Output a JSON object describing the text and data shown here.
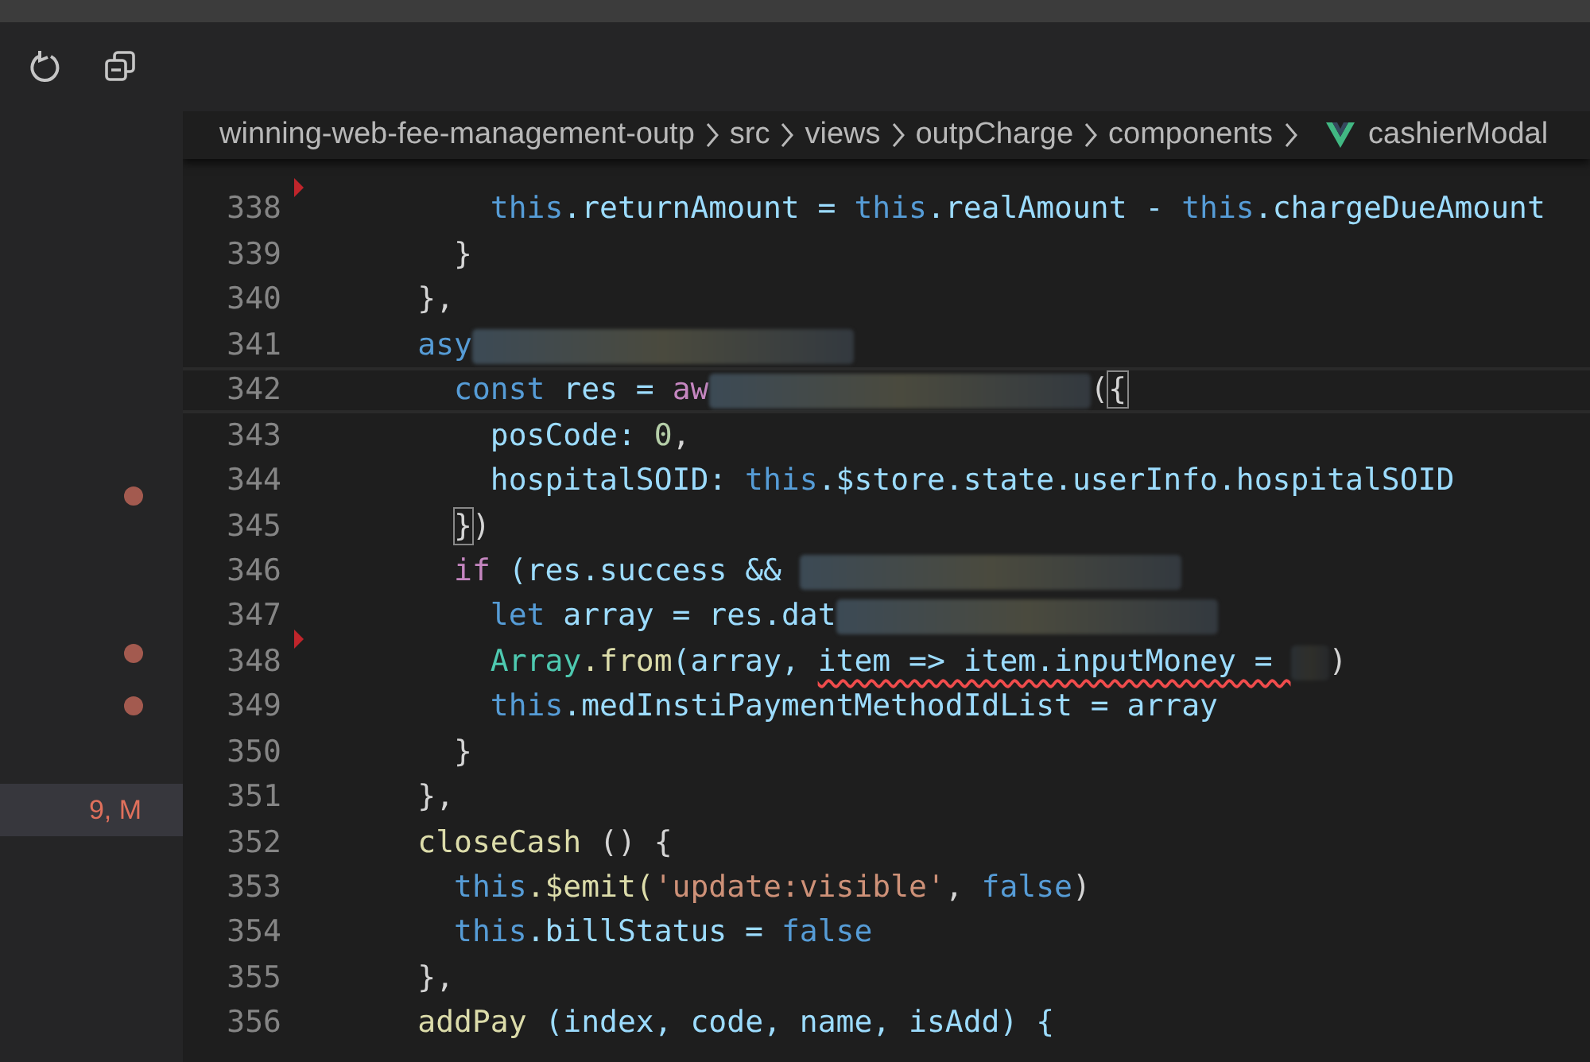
{
  "toolbar": {
    "buttons": [
      {
        "kind": "refresh"
      },
      {
        "kind": "collapse"
      }
    ]
  },
  "sidebar": {
    "rows": [
      {
        "kind": "dot",
        "selected": false
      },
      {
        "kind": "blank",
        "selected": false
      },
      {
        "kind": "blank",
        "selected": false
      },
      {
        "kind": "dot",
        "selected": false
      },
      {
        "kind": "dot",
        "selected": false
      },
      {
        "kind": "blank",
        "selected": false
      },
      {
        "kind": "badge",
        "text": "9, M",
        "selected": true
      }
    ]
  },
  "breadcrumb": [
    {
      "text": "winning-web-fee-management-outp"
    },
    {
      "text": "src"
    },
    {
      "text": "views"
    },
    {
      "text": "outpCharge"
    },
    {
      "text": "components"
    },
    {
      "text": "cashierModal",
      "kind": "vue"
    }
  ],
  "editor": {
    "lines": [
      {
        "number": "338",
        "marker": true,
        "current": false,
        "tokens": [
          {
            "text": "          this",
            "kind": "kw"
          },
          {
            "text": ".returnAmount = ",
            "kind": "var"
          },
          {
            "text": "this",
            "kind": "kw"
          },
          {
            "text": ".realAmount - ",
            "kind": "var"
          },
          {
            "text": "this",
            "kind": "kw"
          },
          {
            "text": ".chargeDueAmount",
            "kind": "var"
          }
        ]
      },
      {
        "number": "339",
        "marker": false,
        "current": false,
        "tokens": [
          {
            "text": "        }",
            "kind": "p"
          }
        ]
      },
      {
        "number": "340",
        "marker": false,
        "current": false,
        "tokens": [
          {
            "text": "      },",
            "kind": "p"
          }
        ]
      },
      {
        "number": "341",
        "marker": false,
        "current": false,
        "tokens": [
          {
            "text": "      asy",
            "kind": "kw"
          },
          {
            "kind": "redacted"
          }
        ]
      },
      {
        "number": "342",
        "marker": false,
        "current": true,
        "tokens": [
          {
            "text": "        const",
            "kind": "kw"
          },
          {
            "text": " res = ",
            "kind": "var"
          },
          {
            "text": "aw",
            "kind": "ctl"
          },
          {
            "kind": "redacted"
          },
          {
            "text": "(",
            "kind": "p"
          },
          {
            "text": "{",
            "kind": "match"
          }
        ]
      },
      {
        "number": "343",
        "marker": false,
        "current": false,
        "tokens": [
          {
            "text": "          posCode: ",
            "kind": "var"
          },
          {
            "text": "0",
            "kind": "num"
          },
          {
            "text": ",",
            "kind": "p"
          }
        ]
      },
      {
        "number": "344",
        "marker": false,
        "current": false,
        "tokens": [
          {
            "text": "          hospitalSOID: ",
            "kind": "var"
          },
          {
            "text": "this",
            "kind": "kw"
          },
          {
            "text": ".$store.state.userInfo.hospitalSOID",
            "kind": "var"
          }
        ]
      },
      {
        "number": "345",
        "marker": false,
        "current": false,
        "tokens": [
          {
            "text": "        }",
            "kind": "match"
          },
          {
            "text": ")",
            "kind": "p"
          }
        ]
      },
      {
        "number": "346",
        "marker": false,
        "current": false,
        "tokens": [
          {
            "text": "        if",
            "kind": "ctl"
          },
          {
            "text": " (res.success && ",
            "kind": "var"
          },
          {
            "kind": "redacted"
          }
        ]
      },
      {
        "number": "347",
        "marker": false,
        "current": false,
        "tokens": [
          {
            "text": "          let",
            "kind": "kw"
          },
          {
            "text": " array = res.dat",
            "kind": "var"
          },
          {
            "kind": "redacted"
          }
        ]
      },
      {
        "number": "348",
        "marker": true,
        "current": false,
        "tokens": [
          {
            "text": "          Array",
            "kind": "type"
          },
          {
            "text": ".from",
            "kind": "fn"
          },
          {
            "text": "(array, ",
            "kind": "var"
          },
          {
            "text": "item => item.inputMoney = ",
            "kind": "var",
            "error": true
          },
          {
            "kind": "smudge"
          },
          {
            "text": ")",
            "kind": "p"
          }
        ]
      },
      {
        "number": "349",
        "marker": false,
        "current": false,
        "tokens": [
          {
            "text": "          this",
            "kind": "kw"
          },
          {
            "text": ".medInstiPaymentMethodIdList = array",
            "kind": "var"
          }
        ]
      },
      {
        "number": "350",
        "marker": false,
        "current": false,
        "tokens": [
          {
            "text": "        }",
            "kind": "p"
          }
        ]
      },
      {
        "number": "351",
        "marker": false,
        "current": false,
        "tokens": [
          {
            "text": "      },",
            "kind": "p"
          }
        ]
      },
      {
        "number": "352",
        "marker": false,
        "current": false,
        "tokens": [
          {
            "text": "      closeCash",
            "kind": "fn"
          },
          {
            "text": " () {",
            "kind": "p"
          }
        ]
      },
      {
        "number": "353",
        "marker": false,
        "current": false,
        "tokens": [
          {
            "text": "        this",
            "kind": "kw"
          },
          {
            "text": ".$emit(",
            "kind": "fn"
          },
          {
            "text": "'update:visible'",
            "kind": "str"
          },
          {
            "text": ", ",
            "kind": "p"
          },
          {
            "text": "false",
            "kind": "kw"
          },
          {
            "text": ")",
            "kind": "p"
          }
        ]
      },
      {
        "number": "354",
        "marker": false,
        "current": false,
        "tokens": [
          {
            "text": "        this",
            "kind": "kw"
          },
          {
            "text": ".billStatus = ",
            "kind": "var"
          },
          {
            "text": "false",
            "kind": "kw"
          }
        ]
      },
      {
        "number": "355",
        "marker": false,
        "current": false,
        "tokens": [
          {
            "text": "      },",
            "kind": "p"
          }
        ]
      },
      {
        "number": "356",
        "marker": false,
        "current": false,
        "tokens": [
          {
            "text": "      addPay",
            "kind": "fn"
          },
          {
            "text": " (index, code, name, isAdd) {",
            "kind": "var"
          }
        ]
      }
    ]
  }
}
